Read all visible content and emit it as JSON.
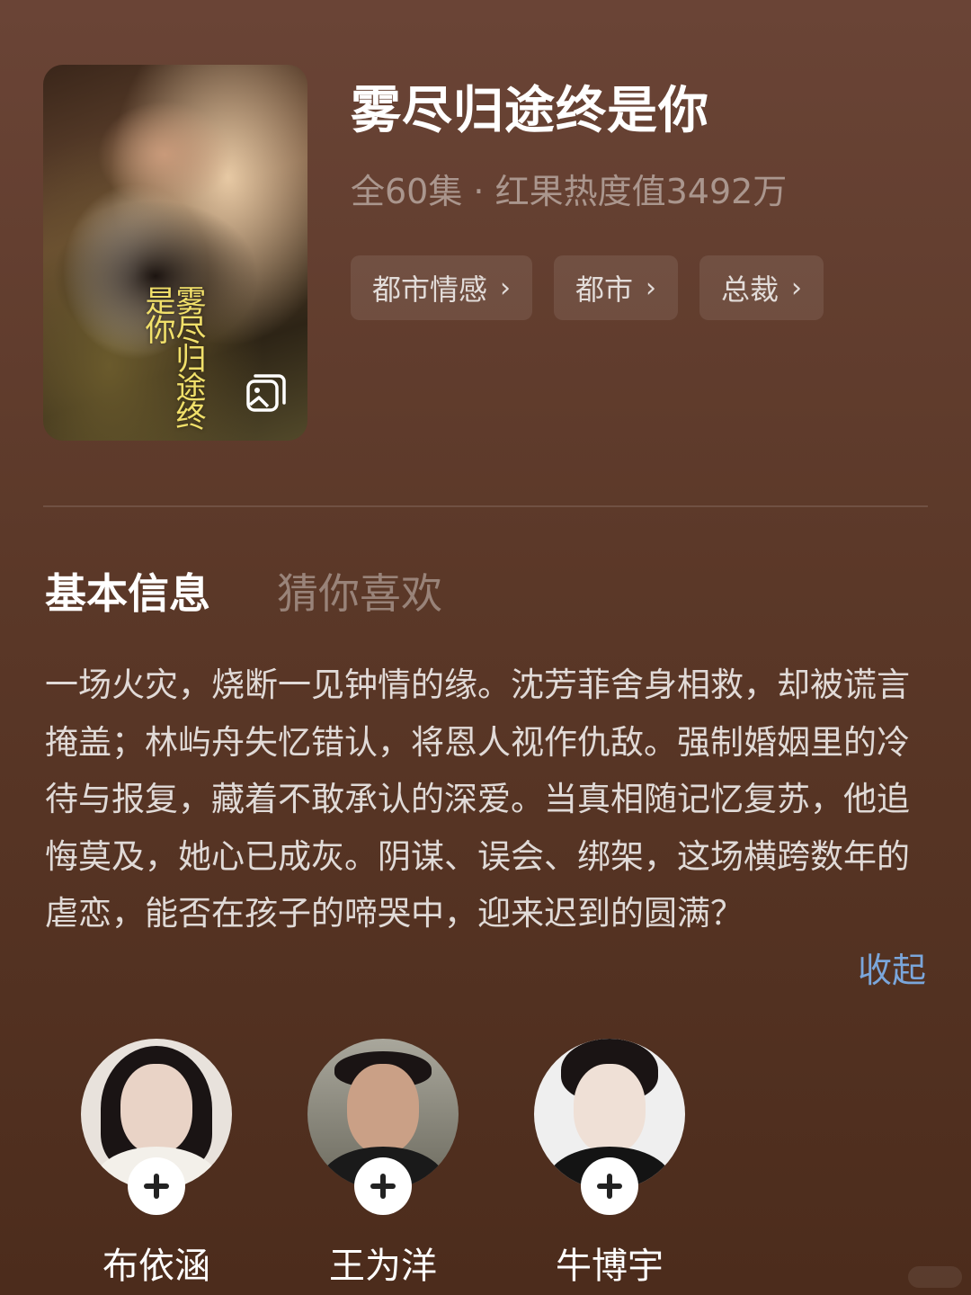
{
  "drama": {
    "title": "雾尽归途终是你",
    "meta": "全60集 · 红果热度值3492万",
    "poster_title": "雾尽归途终是你",
    "tags": [
      "都市情感",
      "都市",
      "总裁"
    ]
  },
  "tabs": [
    "基本信息",
    "猜你喜欢"
  ],
  "active_tab": "基本信息",
  "description": "一场火灾，烧断一见钟情的缘。沈芳菲舍身相救，却被谎言掩盖；林屿舟失忆错认，将恩人视作仇敌。强制婚姻里的冷待与报复，藏着不敢承认的深爱。当真相随记忆复苏，他追悔莫及，她心已成灰。阴谋、误会、绑架，这场横跨数年的虐恋，能否在孩子的啼哭中，迎来迟到的圆满？",
  "collapse_label": "收起",
  "cast": [
    {
      "name": "布依涵"
    },
    {
      "name": "王为洋"
    },
    {
      "name": "牛博宇"
    }
  ],
  "icons": {
    "gallery": "gallery-icon",
    "chevron": "chevron-right-icon",
    "add": "plus-icon"
  },
  "colors": {
    "background_top": "#6a4436",
    "background_bottom": "#4c2c1c",
    "link": "#7aa6db",
    "poster_title": "#f1e06a"
  }
}
